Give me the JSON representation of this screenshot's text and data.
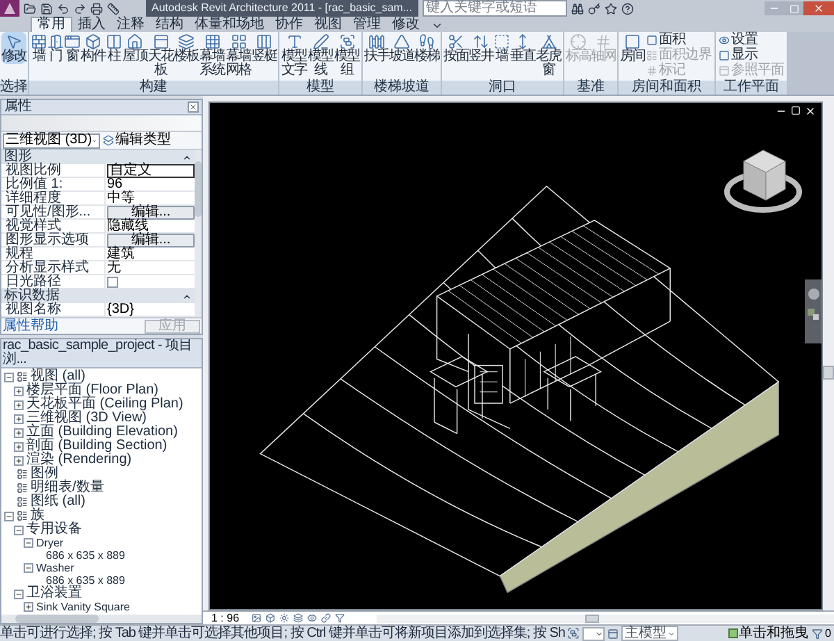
{
  "window": {
    "title": "Autodesk Revit Architecture 2011 - [rac_basic_sam..."
  },
  "search": {
    "placeholder": "键入关键字或短语"
  },
  "tabs": [
    {
      "label": "常用",
      "selected": true
    },
    {
      "label": "插入",
      "selected": false
    },
    {
      "label": "注释",
      "selected": false
    },
    {
      "label": "结构",
      "selected": false
    },
    {
      "label": "体量和场地",
      "selected": false
    },
    {
      "label": "协作",
      "selected": false
    },
    {
      "label": "视图",
      "selected": false
    },
    {
      "label": "管理",
      "selected": false
    },
    {
      "label": "修改",
      "selected": false
    }
  ],
  "ribbon_panels": [
    {
      "title": "选择",
      "buttons": [
        {
          "label": "修改",
          "kind": "large",
          "active": true,
          "disabled": false
        }
      ]
    },
    {
      "title": "构建",
      "buttons": [
        {
          "label": "墙",
          "kind": "large",
          "active": false,
          "disabled": false
        },
        {
          "label": "门",
          "kind": "large",
          "active": false,
          "disabled": false
        },
        {
          "label": "窗",
          "kind": "large",
          "active": false,
          "disabled": false
        },
        {
          "label": "构件",
          "kind": "large",
          "active": false,
          "disabled": false
        },
        {
          "label": "柱",
          "kind": "large",
          "active": false,
          "disabled": false
        },
        {
          "label": "屋顶",
          "kind": "large",
          "active": false,
          "disabled": false
        },
        {
          "label": "天花板",
          "kind": "large",
          "active": false,
          "disabled": false
        },
        {
          "label": "楼板",
          "kind": "large",
          "active": false,
          "disabled": false
        },
        {
          "label": "幕墙系统",
          "kind": "large",
          "active": false,
          "disabled": false
        },
        {
          "label": "幕墙网格",
          "kind": "large",
          "active": false,
          "disabled": false
        },
        {
          "label": "竖梃",
          "kind": "large",
          "active": false,
          "disabled": false
        }
      ]
    },
    {
      "title": "模型",
      "buttons": [
        {
          "label": "模型文字",
          "kind": "large",
          "active": false,
          "disabled": false
        },
        {
          "label": "模型线",
          "kind": "large",
          "active": false,
          "disabled": false
        },
        {
          "label": "模型组",
          "kind": "large",
          "active": false,
          "disabled": false
        }
      ]
    },
    {
      "title": "楼梯坡道",
      "buttons": [
        {
          "label": "扶手",
          "kind": "large",
          "active": false,
          "disabled": false
        },
        {
          "label": "坡道",
          "kind": "large",
          "active": false,
          "disabled": false
        },
        {
          "label": "楼梯",
          "kind": "large",
          "active": false,
          "disabled": false
        }
      ]
    },
    {
      "title": "洞口",
      "buttons": [
        {
          "label": "按面",
          "kind": "large",
          "active": false,
          "disabled": false
        },
        {
          "label": "竖井",
          "kind": "large",
          "active": false,
          "disabled": false
        },
        {
          "label": "墙",
          "kind": "large",
          "active": false,
          "disabled": false
        },
        {
          "label": "垂直",
          "kind": "large",
          "active": false,
          "disabled": false
        },
        {
          "label": "老虎窗",
          "kind": "large",
          "active": false,
          "disabled": false
        }
      ]
    },
    {
      "title": "基准",
      "buttons": [
        {
          "label": "标高",
          "kind": "large",
          "active": false,
          "disabled": true
        },
        {
          "label": "轴网",
          "kind": "large",
          "active": false,
          "disabled": true
        }
      ]
    },
    {
      "title": "房间和面积",
      "buttons": [
        {
          "label": "房间",
          "kind": "large",
          "active": false,
          "disabled": false
        },
        {
          "label": "面积",
          "kind": "small",
          "active": false,
          "disabled": false
        },
        {
          "label": "面积边界",
          "kind": "small",
          "active": false,
          "disabled": true
        },
        {
          "label": "标记",
          "kind": "small",
          "active": false,
          "disabled": true
        }
      ]
    },
    {
      "title": "工作平面",
      "buttons": [
        {
          "label": "设置",
          "kind": "small",
          "active": false,
          "disabled": false
        },
        {
          "label": "显示",
          "kind": "small",
          "active": false,
          "disabled": false
        },
        {
          "label": "参照平面",
          "kind": "small",
          "active": false,
          "disabled": true
        }
      ]
    }
  ],
  "properties": {
    "title": "属性",
    "type_selector": "三维视图 (3D)",
    "edit_type": "编辑类型",
    "groups": [
      {
        "title": "图形",
        "expanded": true,
        "rows": [
          {
            "label": "视图比例",
            "value": "自定义",
            "kind": "field"
          },
          {
            "label": "比例值 1:",
            "value": "96",
            "kind": "text"
          },
          {
            "label": "详细程度",
            "value": "中等",
            "kind": "text"
          },
          {
            "label": "可见性/图形...",
            "value": "编辑...",
            "kind": "button"
          },
          {
            "label": "视觉样式",
            "value": "隐藏线",
            "kind": "text"
          },
          {
            "label": "图形显示选项",
            "value": "编辑...",
            "kind": "button"
          },
          {
            "label": "规程",
            "value": "建筑",
            "kind": "text"
          },
          {
            "label": "分析显示样式",
            "value": "无",
            "kind": "text"
          },
          {
            "label": "日光路径",
            "checked": false,
            "kind": "checkbox"
          }
        ]
      },
      {
        "title": "标识数据",
        "expanded": true,
        "rows": [
          {
            "label": "视图名称",
            "value": "{3D}",
            "kind": "text"
          }
        ]
      }
    ],
    "help_link": "属性帮助",
    "apply": {
      "label": "应用",
      "disabled": true
    }
  },
  "browser": {
    "title": "rac_basic_sample_project - 项目浏...",
    "tree": [
      {
        "label": "视图 (all)",
        "expanded": true,
        "children": [
          {
            "label": "楼层平面 (Floor Plan)",
            "expanded": false
          },
          {
            "label": "天花板平面 (Ceiling Plan)",
            "expanded": false
          },
          {
            "label": "三维视图 (3D View)",
            "expanded": false
          },
          {
            "label": "立面 (Building Elevation)",
            "expanded": false
          },
          {
            "label": "剖面 (Building Section)",
            "expanded": false
          },
          {
            "label": "渲染 (Rendering)",
            "expanded": false
          }
        ]
      },
      {
        "label": "图例"
      },
      {
        "label": "明细表/数量"
      },
      {
        "label": "图纸 (all)"
      },
      {
        "label": "族",
        "expanded": true,
        "children": [
          {
            "label": "专用设备",
            "expanded": true,
            "children": [
              {
                "label": "Dryer",
                "expanded": true,
                "children": [
                  {
                    "label": "686 x 635 x 889"
                  }
                ]
              },
              {
                "label": "Washer",
                "expanded": true,
                "children": [
                  {
                    "label": "686 x 635 x 889"
                  }
                ]
              }
            ]
          },
          {
            "label": "卫浴装置",
            "expanded": true,
            "children": [
              {
                "label": "Sink Vanity Square",
                "expanded": false
              }
            ]
          }
        ]
      }
    ]
  },
  "view": {
    "scale": "1 : 96"
  },
  "status_bar": {
    "message": "单击可进行选择; 按 Tab 键并单击可选择其他项目; 按 Ctrl 键并单击可将新项目添加到选择集; 按 Sh",
    "design_option": "主模型",
    "drag_label": "单击和拖曳",
    "drag_checked": true,
    "filter_count": "0"
  }
}
